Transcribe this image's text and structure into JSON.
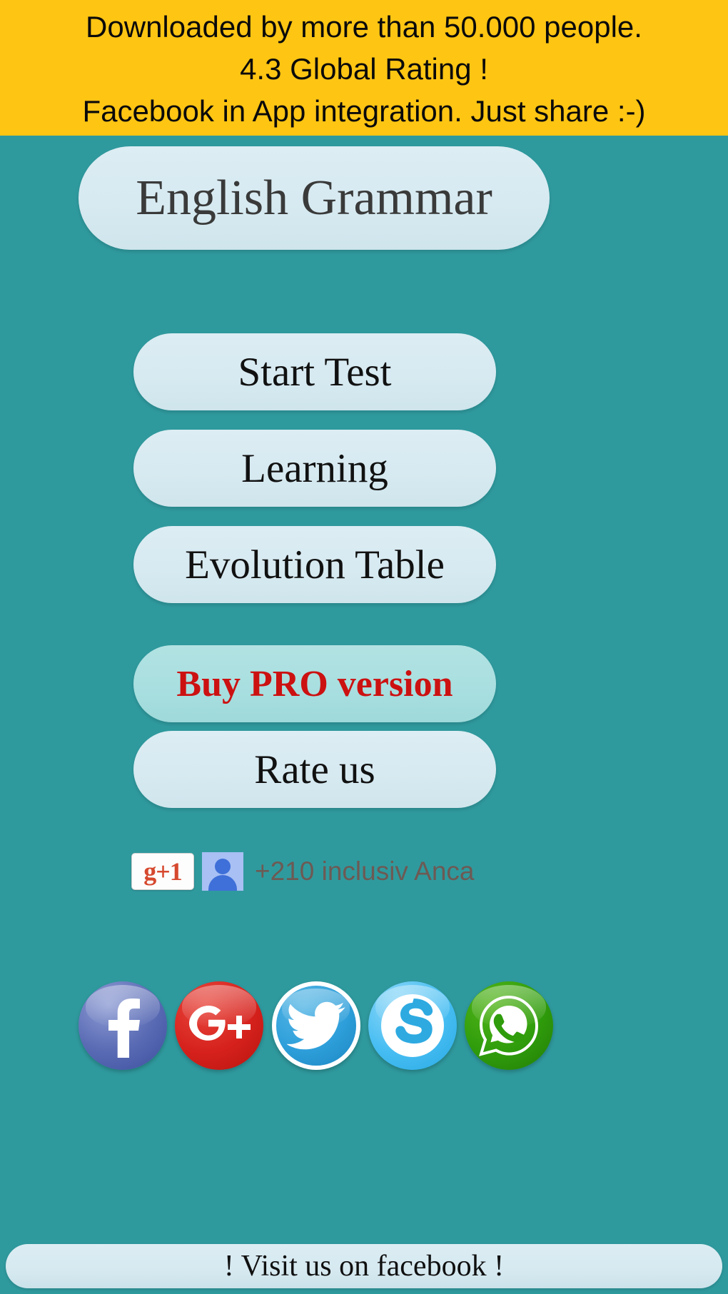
{
  "promo_banner": {
    "background_color": "#ffc513",
    "lines": [
      "Downloaded by more than 50.000 people.",
      "4.3 Global Rating !",
      "Facebook in App integration. Just share :-)"
    ]
  },
  "theme": {
    "background_color": "#2f9a9e",
    "button_color": "#d7eaf1",
    "pro_button_color": "#a9dfe0",
    "pro_text_color": "#cc1111",
    "text_color": "#111111"
  },
  "app": {
    "title": "English Grammar"
  },
  "menu": {
    "start_test": "Start Test",
    "learning": "Learning",
    "evolution_table": "Evolution Table",
    "buy_pro": "Buy PRO version",
    "rate_us": "Rate us"
  },
  "gplus": {
    "plus_one_label": "g+1",
    "count_text": "+210 inclusiv Anca",
    "avatar_icon": "person-icon"
  },
  "social": [
    {
      "name": "facebook",
      "icon": "facebook-icon",
      "color": "#3b4f9e"
    },
    {
      "name": "googleplus",
      "icon": "googleplus-icon",
      "color": "#d6211c"
    },
    {
      "name": "twitter",
      "icon": "twitter-icon",
      "color": "#2e9fda"
    },
    {
      "name": "skype",
      "icon": "skype-icon",
      "color": "#29a9e4"
    },
    {
      "name": "whatsapp",
      "icon": "whatsapp-icon",
      "color": "#2f9c0b"
    }
  ],
  "footer": {
    "label": "! Visit us on facebook !"
  }
}
